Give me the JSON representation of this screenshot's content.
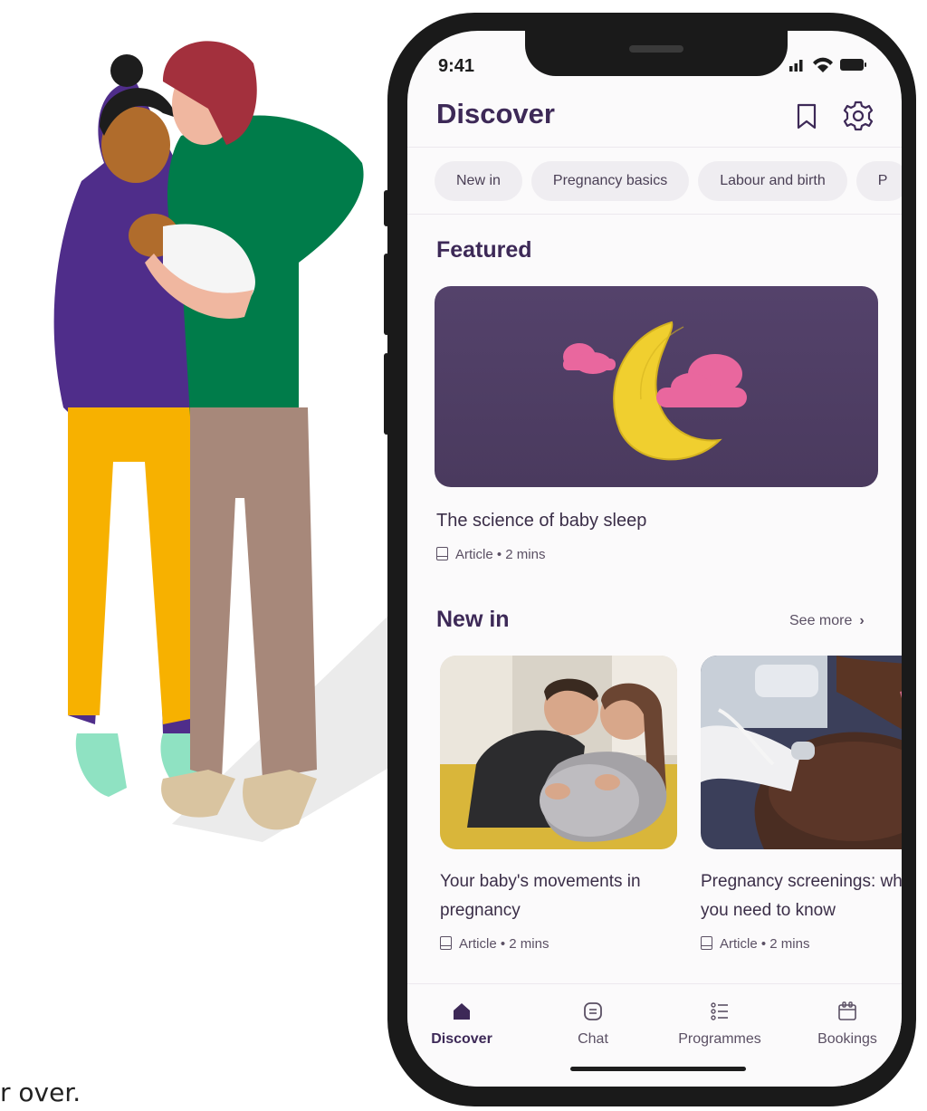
{
  "status": {
    "time": "9:41"
  },
  "header": {
    "title": "Discover"
  },
  "chips": [
    "New in",
    "Pregnancy basics",
    "Labour and birth",
    "P"
  ],
  "featured": {
    "section_title": "Featured",
    "headline": "The science of baby sleep",
    "meta": "Article • 2 mins"
  },
  "new_in": {
    "section_title": "New in",
    "see_more": "See more",
    "cards": [
      {
        "title": "Your baby's movements in pregnancy",
        "meta": "Article • 2 mins"
      },
      {
        "title": "Pregnancy screenings: what you need to know",
        "meta": "Article • 2 mins"
      }
    ]
  },
  "tabs": [
    {
      "label": "Discover",
      "icon": "home-icon",
      "active": true
    },
    {
      "label": "Chat",
      "icon": "chat-icon",
      "active": false
    },
    {
      "label": "Programmes",
      "icon": "list-icon",
      "active": false
    },
    {
      "label": "Bookings",
      "icon": "calendar-icon",
      "active": false
    }
  ],
  "footer_fragment": "r over.",
  "colors": {
    "brand_purple": "#3d2957",
    "card_purple": "#4f3e65",
    "moon_yellow": "#f0cf2f",
    "cloud_pink": "#e9679e"
  }
}
